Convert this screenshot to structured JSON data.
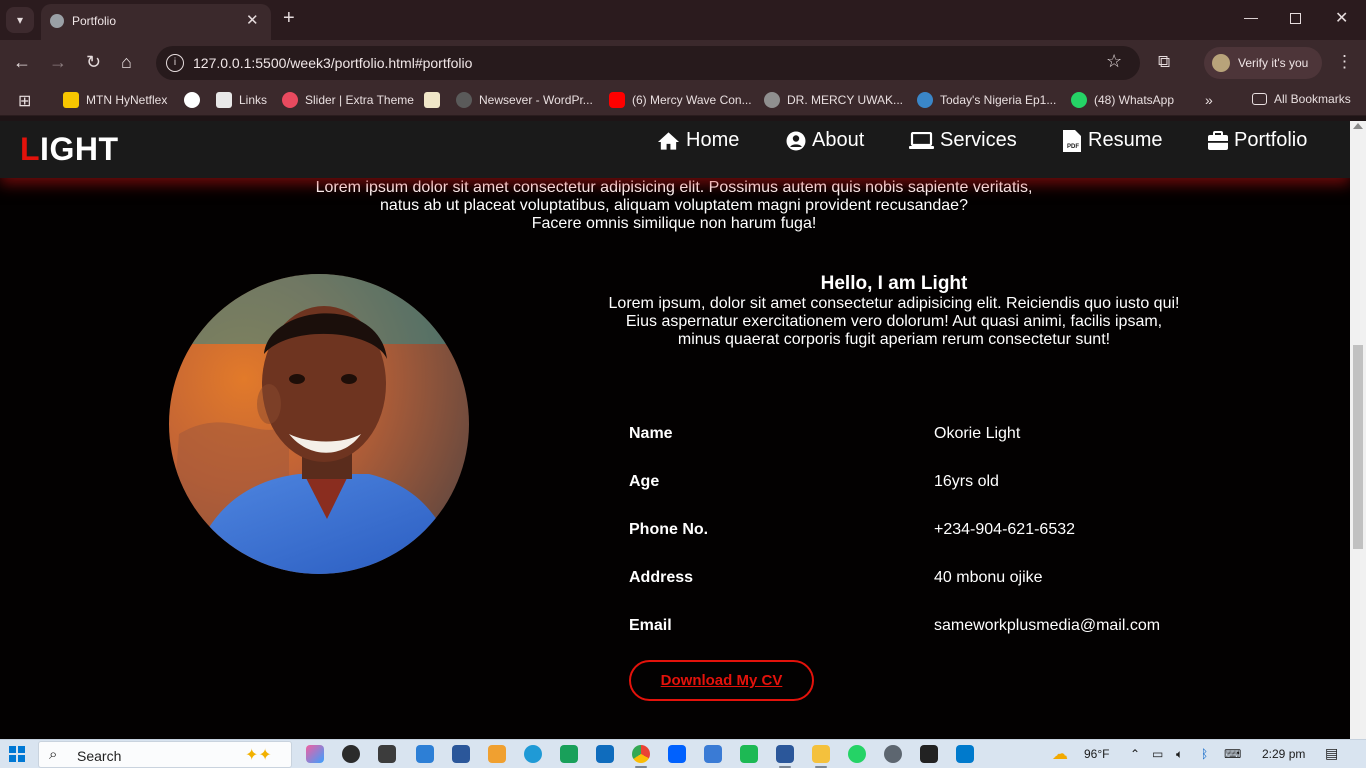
{
  "browser": {
    "tab_title": "Portfolio",
    "url": "127.0.0.1:5500/week3/portfolio.html#portfolio",
    "verify_label": "Verify it's you",
    "bookmarks": [
      {
        "label": "MTN HyNetflex",
        "icon_color": "#f7c600"
      },
      {
        "label": "",
        "icon_color": "#ffffff"
      },
      {
        "label": "Links",
        "icon_color": "#e8e8e8"
      },
      {
        "label": "Slider | Extra Theme",
        "icon_color": "#e84a5f"
      },
      {
        "label": "",
        "icon_color": "#f0e6c8"
      },
      {
        "label": "Newsever - WordPr...",
        "icon_color": "#5a5a5a"
      },
      {
        "label": "(6) Mercy Wave Con...",
        "icon_color": "#ff0000"
      },
      {
        "label": "DR. MERCY UWAK...",
        "icon_color": "#8f8f8f"
      },
      {
        "label": "Today's Nigeria Ep1...",
        "icon_color": "#3a86c8"
      },
      {
        "label": "(48) WhatsApp",
        "icon_color": "#25d366"
      }
    ],
    "all_bookmarks": "All Bookmarks"
  },
  "site": {
    "logo_first": "L",
    "logo_rest": "IGHT",
    "nav": [
      {
        "label": "Home",
        "icon": "home-icon"
      },
      {
        "label": "About",
        "icon": "user-circle-icon"
      },
      {
        "label": "Services",
        "icon": "laptop-icon"
      },
      {
        "label": "Resume",
        "icon": "pdf-file-icon"
      },
      {
        "label": "Portfolio",
        "icon": "briefcase-icon"
      }
    ],
    "intro_lines": [
      "Lorem ipsum dolor sit amet consectetur adipisicing elit. Possimus autem quis nobis sapiente veritatis,",
      "natus ab ut placeat voluptatibus, aliquam voluptatem magni provident recusandae?",
      "Facere omnis similique non harum fuga!"
    ],
    "hello_title": "Hello, I am Light",
    "hello_lines": [
      "Lorem ipsum, dolor sit amet consectetur adipisicing elit. Reiciendis quo iusto qui!",
      "Eius aspernatur exercitationem vero dolorum! Aut quasi animi, facilis ipsam,",
      "minus quaerat corporis fugit aperiam rerum consectetur sunt!"
    ],
    "info": [
      {
        "label": "Name",
        "value": "Okorie Light"
      },
      {
        "label": "Age",
        "value": "16yrs old"
      },
      {
        "label": "Phone No.",
        "value": "+234-904-621-6532"
      },
      {
        "label": "Address",
        "value": "40 mbonu ojike"
      },
      {
        "label": "Email",
        "value": "sameworkplusmedia@mail.com"
      }
    ],
    "cv_button": "Download My CV",
    "accent_color": "#e3120b"
  },
  "taskbar": {
    "search_label": "Search",
    "weather": "96°F",
    "time": "2:29 pm"
  }
}
